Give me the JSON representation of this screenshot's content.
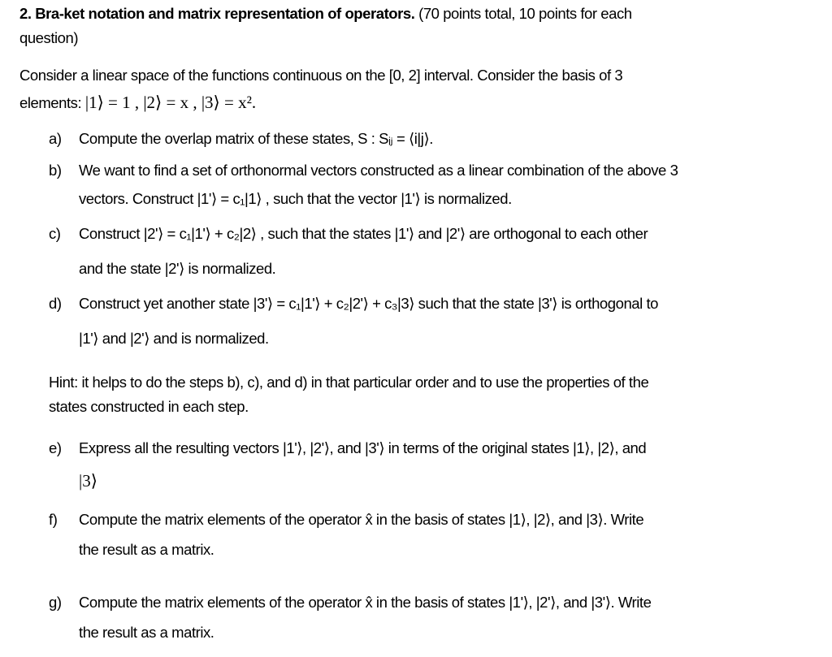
{
  "header": {
    "title_bold": "2. Bra-ket notation and matrix representation of operators.",
    "title_rest": " (70 points total, 10 points for each",
    "title_cont": "question)"
  },
  "intro": {
    "line1": "Consider a linear space of the functions continuous on the [0, 2] interval. Consider the basis of 3",
    "line2_text": "elements: ",
    "line2_math": "|1⟩ = 1 , |2⟩ = x , |3⟩ = x².",
    "kets": [
      "|1⟩",
      "|2⟩",
      "|3⟩"
    ],
    "values": [
      "1",
      "x",
      "x²"
    ]
  },
  "questions": [
    {
      "label": "a)",
      "lines": [
        "Compute the overlap matrix of these states, S : Sᵢⱼ = ⟨i|j⟩."
      ]
    },
    {
      "label": "b)",
      "lines": [
        "We want to find a set of orthonormal vectors constructed as a linear combination of the above 3",
        "vectors. Construct |1'⟩ = c₁|1⟩ , such that the vector |1'⟩ is normalized."
      ]
    },
    {
      "label": "c)",
      "lines": [
        "Construct |2'⟩ = c₁|1'⟩ + c₂|2⟩ , such that the states |1'⟩ and |2'⟩ are orthogonal to each other",
        "and the state |2'⟩ is normalized."
      ]
    },
    {
      "label": "d)",
      "lines": [
        "Construct yet another state |3'⟩ = c₁|1'⟩ + c₂|2'⟩ + c₃|3⟩  such that the state |3'⟩ is orthogonal to",
        "|1'⟩ and |2'⟩ and is normalized."
      ]
    },
    {
      "label": "e)",
      "lines": [
        "Express all the resulting vectors |1'⟩, |2'⟩, and |3'⟩  in terms of the original states |1⟩, |2⟩, and",
        "|3⟩"
      ]
    },
    {
      "label": "f)",
      "lines": [
        "Compute the matrix elements of the operator x̂  in the basis of states |1⟩, |2⟩, and |3⟩. Write",
        "the result as a matrix."
      ]
    },
    {
      "label": "g)",
      "lines": [
        "Compute the matrix elements of the operator x̂  in the basis of states |1'⟩, |2'⟩, and |3'⟩. Write",
        "the result as a matrix."
      ]
    }
  ],
  "hint": {
    "line1": "Hint: it helps to do the steps b), c), and d) in that particular order and to use the properties of the",
    "line2": "states constructed in each step."
  }
}
